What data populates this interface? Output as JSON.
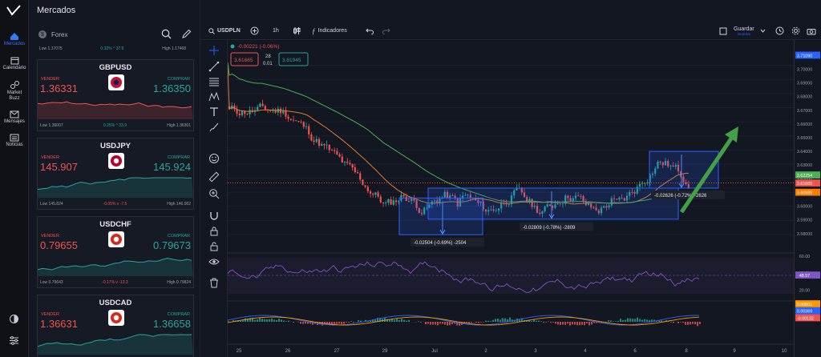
{
  "nav": {
    "items": [
      {
        "label": "Mercados"
      },
      {
        "label": "Calendário"
      },
      {
        "label": "Market Buzz"
      },
      {
        "label": "Mensajes"
      },
      {
        "label": "Noticias"
      }
    ]
  },
  "markets": {
    "title": "Mercados",
    "category": "Forex",
    "top_card": {
      "low": "Low 1.17075",
      "change": "0.32% ^ 37.6",
      "high": "High 1.17468"
    },
    "cards": [
      {
        "pair": "GBPUSD",
        "sell_label": "VENDER",
        "buy_label": "COMPRAR",
        "sell_price": "1.36331",
        "buy_price": "1.36350",
        "low": "Low 1.36007",
        "change": "0.25% ^ 33.9",
        "dir": "up",
        "high": "High 1.36361"
      },
      {
        "pair": "USDJPY",
        "sell_label": "VENDER",
        "buy_label": "COMPRAR",
        "sell_price": "145.907",
        "buy_price": "145.924",
        "low": "Low 145.824",
        "change": "-0.05% v -7.5",
        "dir": "down",
        "high": "High 146.062"
      },
      {
        "pair": "USDCHF",
        "sell_label": "VENDER",
        "buy_label": "COMPRAR",
        "sell_price": "0.79655",
        "buy_price": "0.79673",
        "low": "Low 0.79643",
        "change": "-0.17% v -13.3",
        "dir": "down",
        "high": "High 0.79824"
      },
      {
        "pair": "USDCAD",
        "sell_label": "VENDER",
        "buy_label": "COMPRAR",
        "sell_price": "1.36631",
        "buy_price": "1.36658",
        "low": "",
        "change": "",
        "dir": "up",
        "high": ""
      }
    ]
  },
  "toolbar": {
    "symbol": "USDPLN",
    "interval": "1h",
    "indicators_label": "Indicadores",
    "save_label": "Guardar",
    "save_sub": "Guardar"
  },
  "legend": {
    "change": "-0.00221 (-0.06%)",
    "sell": "3.61665",
    "spread_top": "28",
    "spread_bottom": "0.01",
    "buy": "3.61945"
  },
  "annotations": {
    "range1": "-0.02504 (-0.69%) -2504",
    "range2": "-0.02809 (-0.78%) -2809",
    "range3": "-0.02626 (-0.72%) -2626"
  },
  "price_axis": {
    "ticks": [
      "3.70000",
      "3.69000",
      "3.68000",
      "3.67000",
      "3.66000",
      "3.65000",
      "3.64000",
      "3.63000",
      "3.62000",
      "3.61000",
      "3.60000",
      "3.59000",
      "3.58000"
    ],
    "badges": [
      {
        "value": "3.71090",
        "color": "#2962ff"
      },
      {
        "value": "3.62254",
        "color": "#4caf50"
      },
      {
        "value": "3.61665",
        "color": "#ef5350"
      },
      {
        "value": "3.60989",
        "color": "#f57c00"
      }
    ]
  },
  "rsi_axis": {
    "ticks": [
      "60.00",
      "40.00",
      "20.00"
    ],
    "badge": "48.57"
  },
  "macd_axis": {
    "badges": [
      "0.00501",
      "0.00369",
      "-0.00132"
    ]
  },
  "time_axis": {
    "labels": [
      "25",
      "26",
      "27",
      "29",
      "Jul",
      "2",
      "3",
      "4",
      "6",
      "8",
      "9",
      "10"
    ]
  },
  "colors": {
    "up": "#26a69a",
    "down": "#ef5350",
    "ma_fast": "#e07b2c",
    "ma_slow": "#4caf50",
    "accent": "#2962ff"
  }
}
